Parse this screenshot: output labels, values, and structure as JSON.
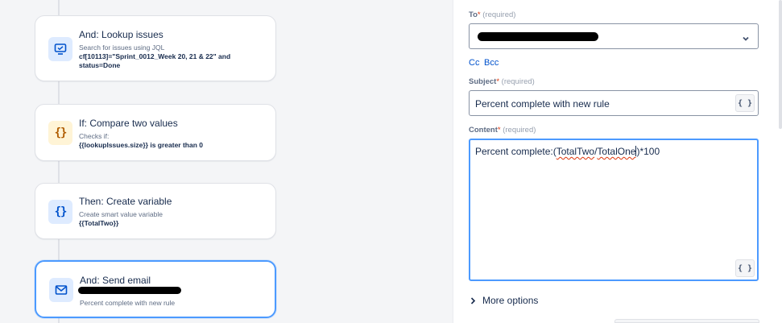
{
  "flow": {
    "cards": [
      {
        "title": "And: Lookup issues",
        "desc_line1": "Search for issues using JQL",
        "desc_bold": "cf[10113]=\"Sprint_0012_Week 20, 21 & 22\" and status=Done",
        "icon": "monitor-check-icon"
      },
      {
        "title": "If: Compare two values",
        "desc_line1": "Checks if:",
        "desc_bold": "{{lookupIssues.size}} is greater than 0",
        "icon": "braces-icon"
      },
      {
        "title": "Then: Create variable",
        "desc_line1": "Create smart value variable",
        "desc_bold": "{{TotalTwo}}",
        "icon": "braces-icon"
      },
      {
        "title": "And: Send email",
        "desc_line1": "Percent complete with new rule",
        "icon": "envelope-icon"
      }
    ],
    "braces_glyph": "{}"
  },
  "email": {
    "to_label": "To",
    "to_required": "(required)",
    "cc_label": "Cc",
    "bcc_label": "Bcc",
    "subject_label": "Subject",
    "subject_required": "(required)",
    "subject_value": "Percent complete with new rule",
    "content_label": "Content",
    "content_required": "(required)",
    "content_prefix": "Percent complete:(",
    "content_word1": "TotalTwo",
    "content_slash": "/",
    "content_word2": "TotalOne",
    "content_suffix": ")*100",
    "smart_value_glyph": "{ }",
    "required_star": "*",
    "more_options": "More options"
  },
  "colors": {
    "accent": "#0052cc",
    "selected_border": "#4c9aff",
    "required": "#de350b"
  }
}
